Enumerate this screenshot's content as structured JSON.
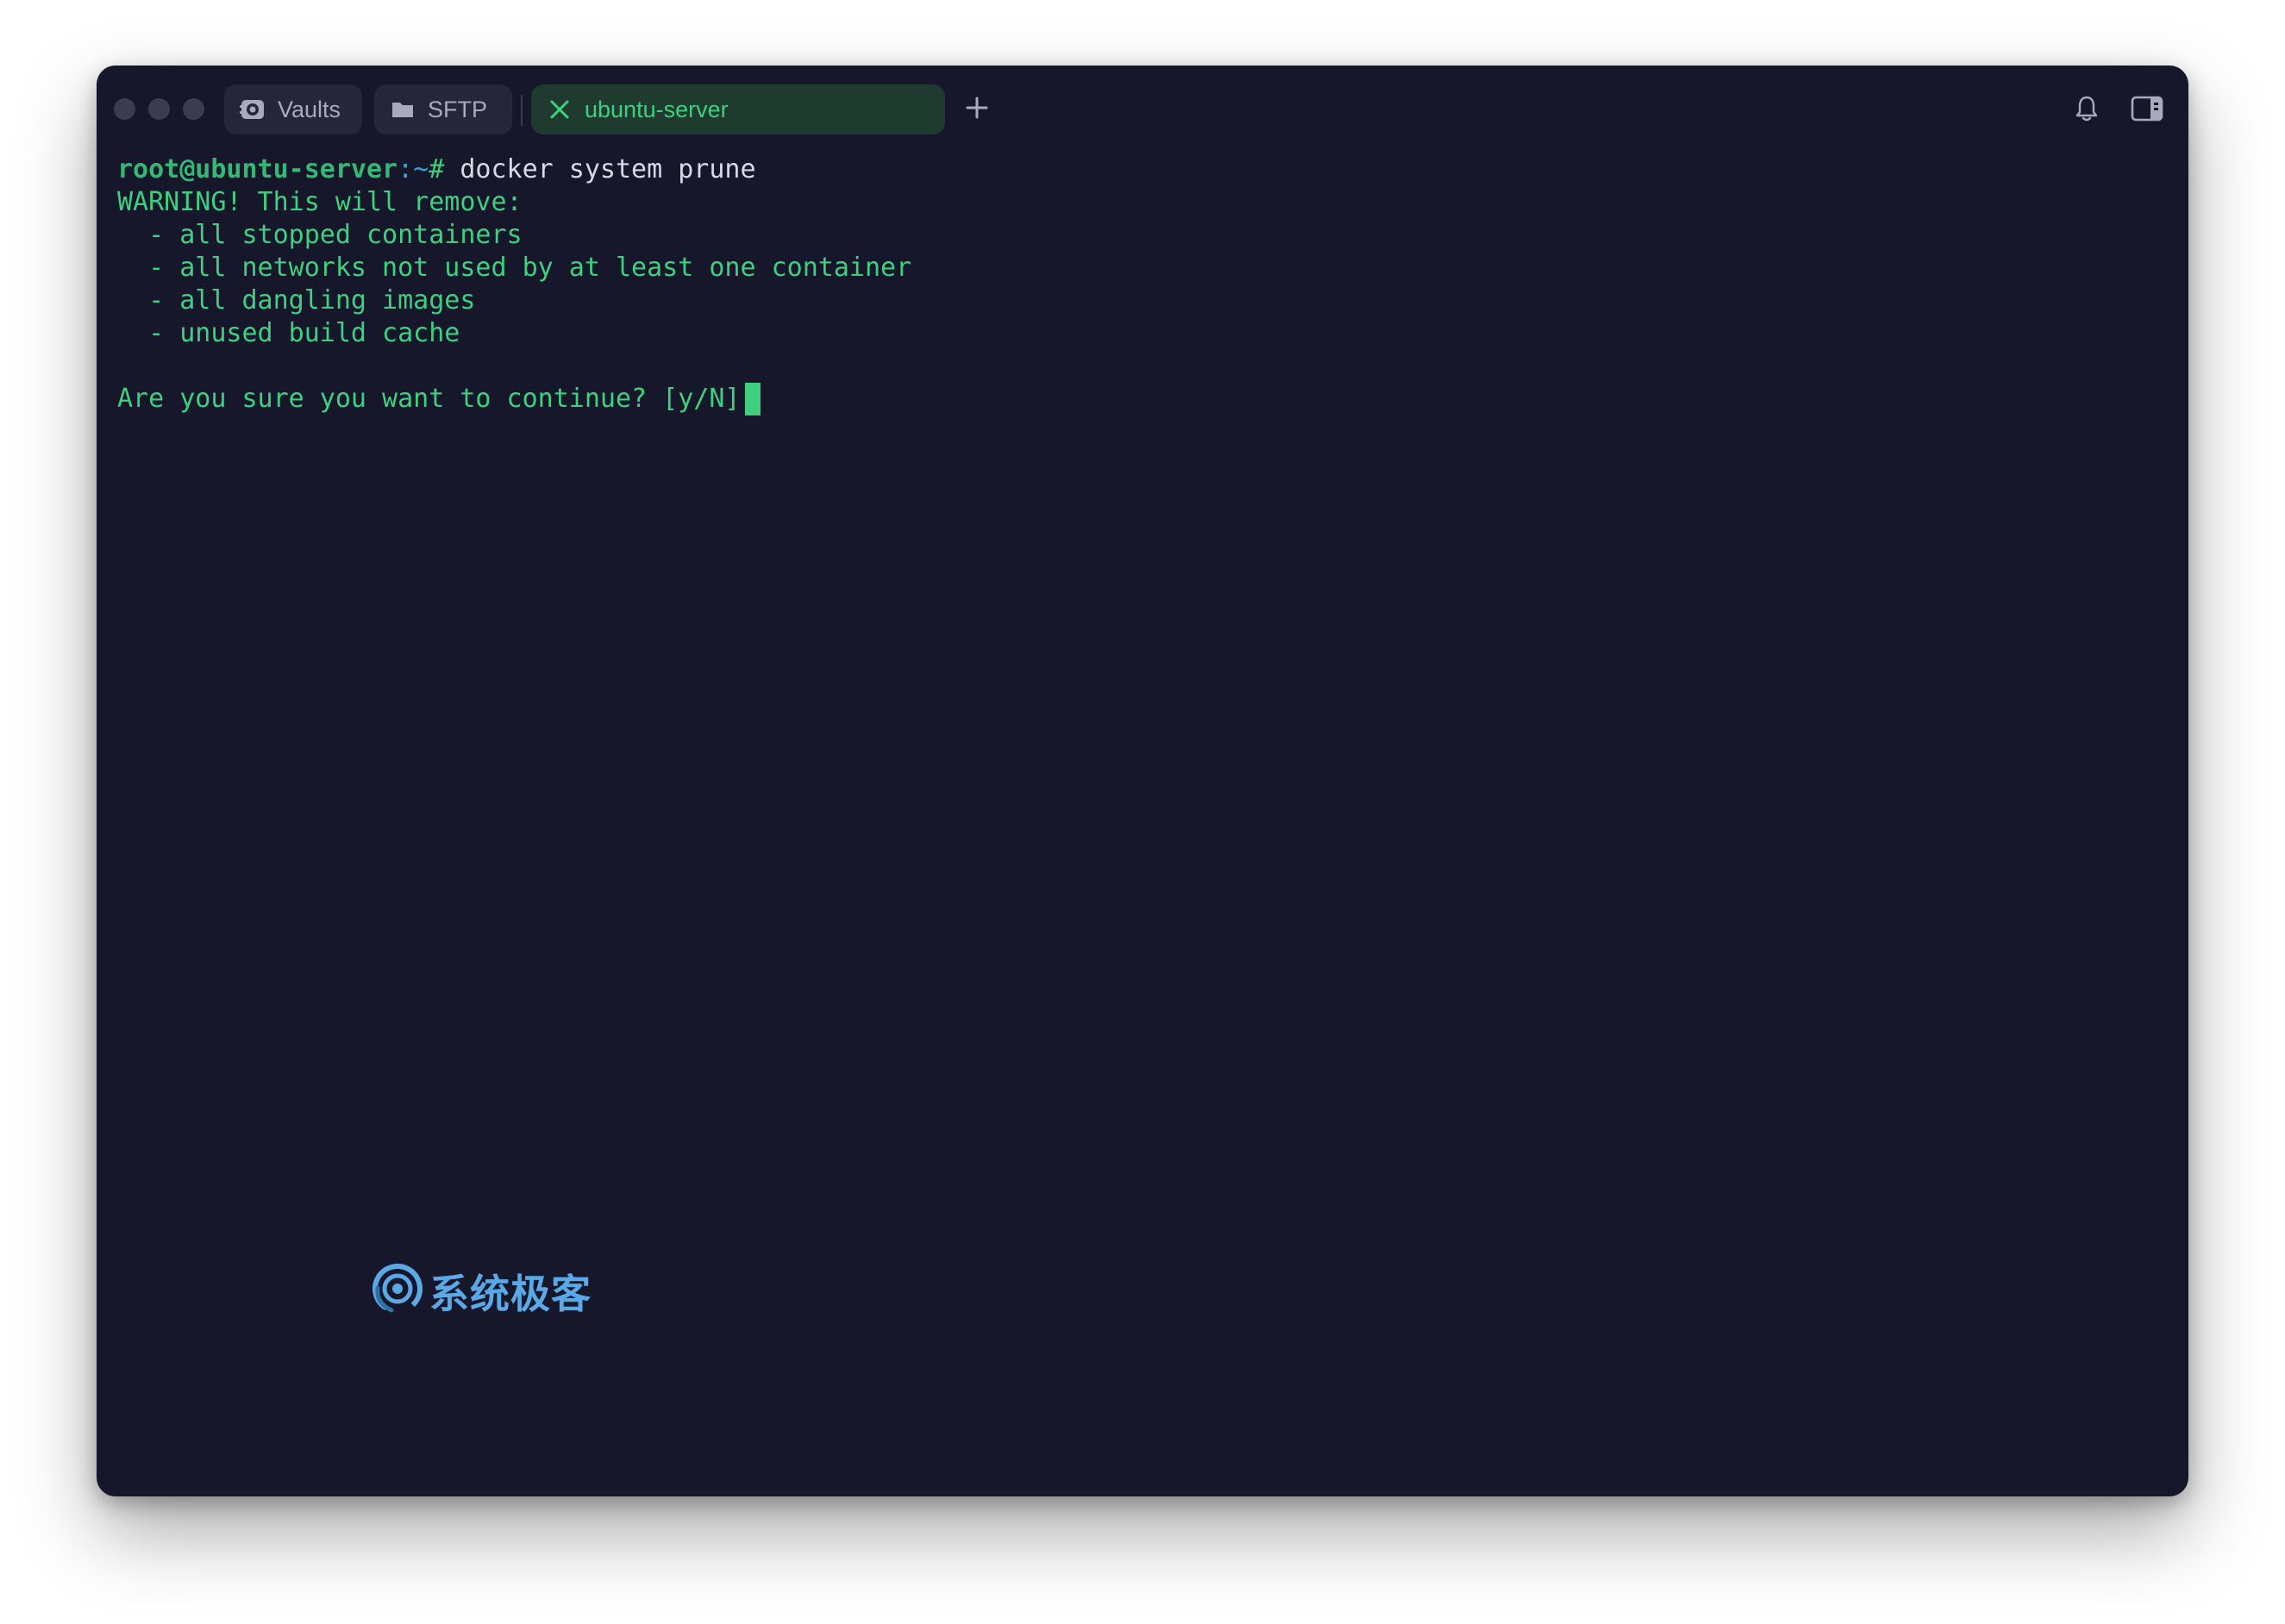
{
  "tabs": [
    {
      "label": "Vaults",
      "icon": "vault-icon",
      "active": false
    },
    {
      "label": "SFTP",
      "icon": "folder-icon",
      "active": false
    },
    {
      "label": "ubuntu-server",
      "icon": "close-icon",
      "active": true
    }
  ],
  "toolbar": {
    "new_tab_icon": "plus-icon",
    "notifications_icon": "bell-icon",
    "panel_icon": "sidebar-toggle-icon"
  },
  "terminal": {
    "prompt_user": "root@ubuntu-server",
    "prompt_path": ":~",
    "prompt_hash": "#",
    "command": " docker system prune",
    "output": [
      "WARNING! This will remove:",
      "  - all stopped containers",
      "  - all networks not used by at least one container",
      "  - all dangling images",
      "  - unused build cache",
      "",
      "Are you sure you want to continue? [y/N]"
    ]
  },
  "watermark": {
    "text": "系统极客"
  },
  "colors": {
    "background": "#16172b",
    "terminal_text": "#3ed07e",
    "active_tab_bg": "#1f3a2e",
    "tab_bg": "#252739",
    "watermark": "#5aa9e6"
  }
}
